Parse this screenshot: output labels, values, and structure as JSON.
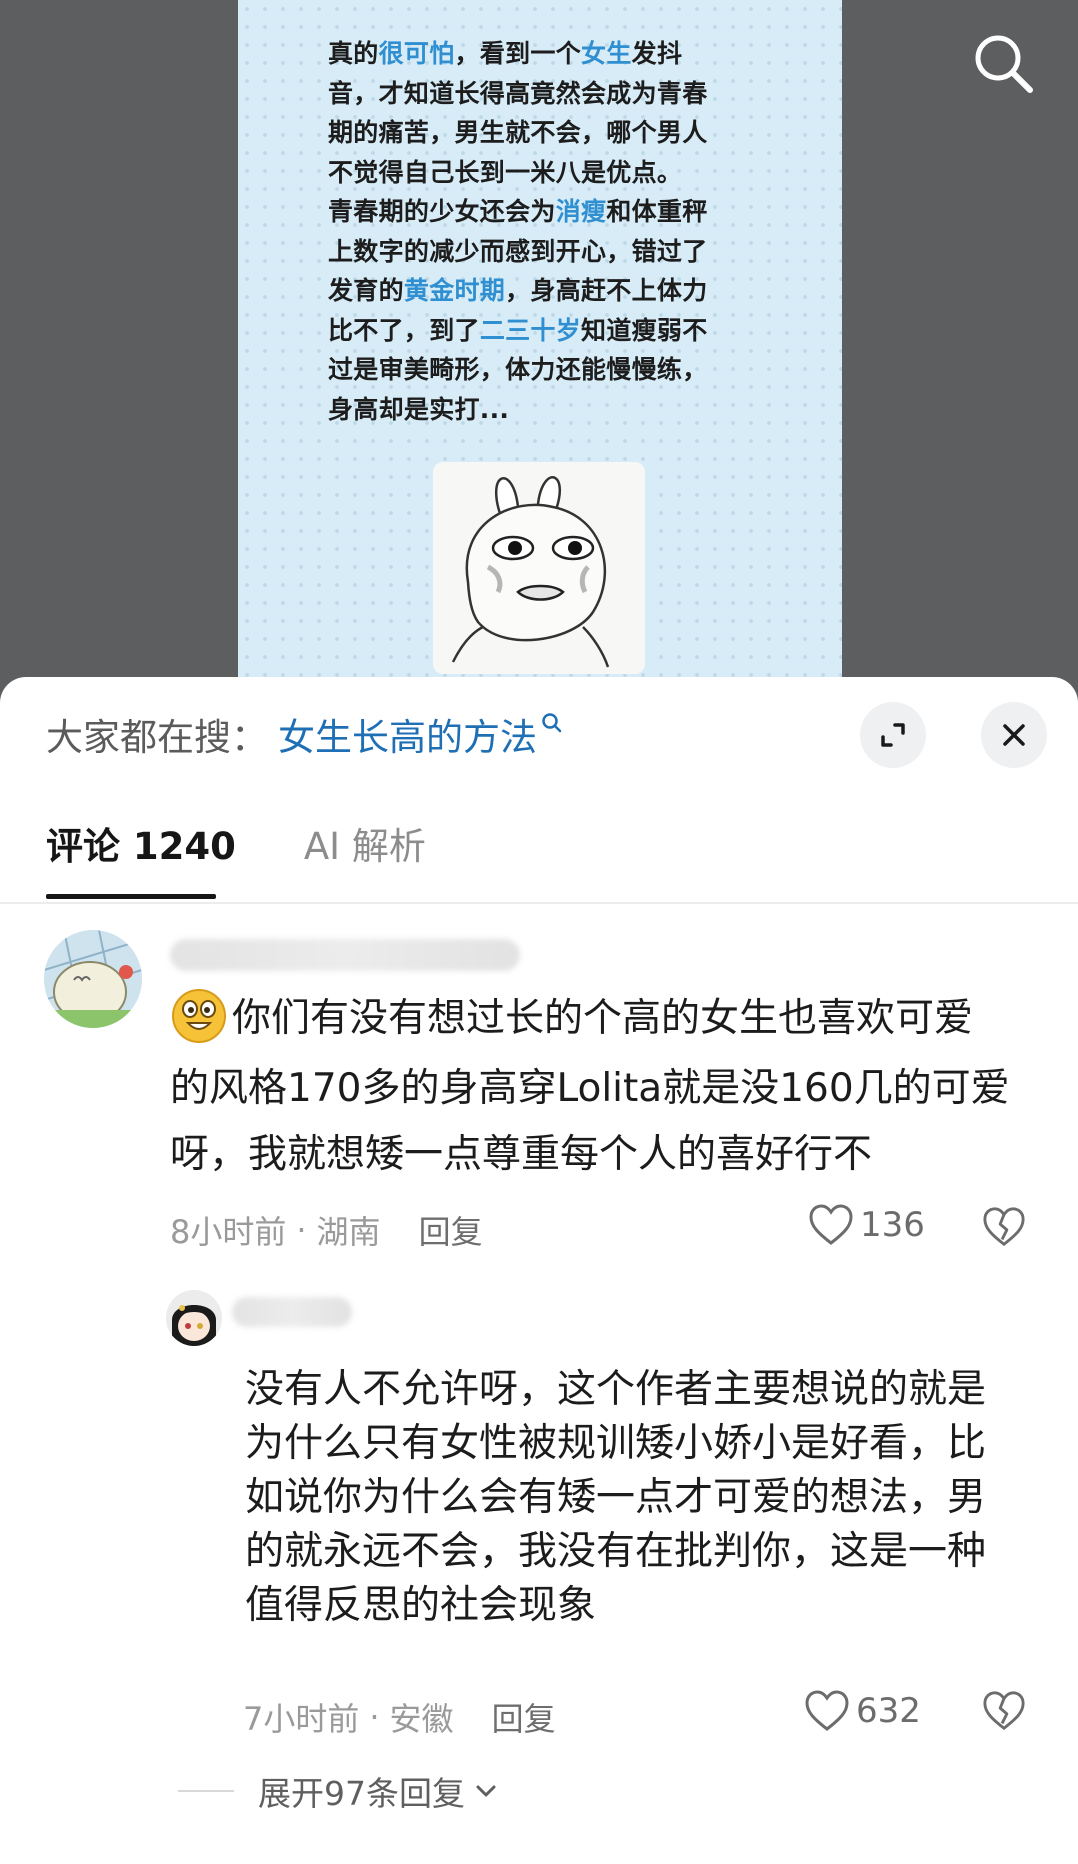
{
  "post": {
    "lines": [
      [
        {
          "t": "真的",
          "h": false
        },
        {
          "t": "很可怕",
          "h": true
        },
        {
          "t": "，看到一个",
          "h": false
        },
        {
          "t": "女生",
          "h": true
        },
        {
          "t": "发抖",
          "h": false
        }
      ],
      [
        {
          "t": "音，才知道长得高竟然会成为青春",
          "h": false
        }
      ],
      [
        {
          "t": "期的痛苦，男生就不会，哪个男人",
          "h": false
        }
      ],
      [
        {
          "t": "不觉得自己长到一米八是优点。",
          "h": false
        }
      ],
      [
        {
          "t": "青春期的少女还会为",
          "h": false
        },
        {
          "t": "消瘦",
          "h": true
        },
        {
          "t": "和体重秤",
          "h": false
        }
      ],
      [
        {
          "t": "上数字的减少而感到开心，错过了",
          "h": false
        }
      ],
      [
        {
          "t": "发育的",
          "h": false
        },
        {
          "t": "黄金时期",
          "h": true
        },
        {
          "t": "，身高赶不上体力",
          "h": false
        }
      ],
      [
        {
          "t": "比不了，到了",
          "h": false
        },
        {
          "t": "二三十岁",
          "h": true
        },
        {
          "t": "知道瘦弱不",
          "h": false
        }
      ],
      [
        {
          "t": "过是审美畸形，体力还能慢慢练，",
          "h": false
        }
      ],
      [
        {
          "t": "身高却是实打...",
          "h": false
        }
      ]
    ],
    "highlight_color": "#2f8fd1"
  },
  "search_icon": "search-icon",
  "sheet": {
    "trending_label": "大家都在搜：",
    "trending_query": "女生长高的方法",
    "tabs": [
      {
        "label": "评论 1240",
        "active": true
      },
      {
        "label": "AI 解析",
        "active": false
      }
    ]
  },
  "comments": [
    {
      "emoji": "grinning-emoji",
      "lines": [
        "你们有没有想过长的个高的女生也喜欢可爱",
        "的风格170多的身高穿Lolita就是没160几的可爱",
        "呀，我就想矮一点尊重每个人的喜好行不"
      ],
      "time": "8小时前",
      "location": "湖南",
      "reply_label": "回复",
      "likes": "136"
    }
  ],
  "reply": {
    "lines": [
      "没有人不允许呀，这个作者主要想说的就是",
      "为什么只有女性被规训矮小娇小是好看，比",
      "如说你为什么会有矮一点才可爱的想法，男",
      "的就永远不会，我没有在批判你，这是一种",
      "值得反思的社会现象"
    ],
    "time": "7小时前",
    "location": "安徽",
    "reply_label": "回复",
    "likes": "632"
  },
  "expand_replies": "展开97条回复",
  "colors": {
    "accent": "#1f6fb5",
    "card_bg": "#d7ecf7"
  }
}
